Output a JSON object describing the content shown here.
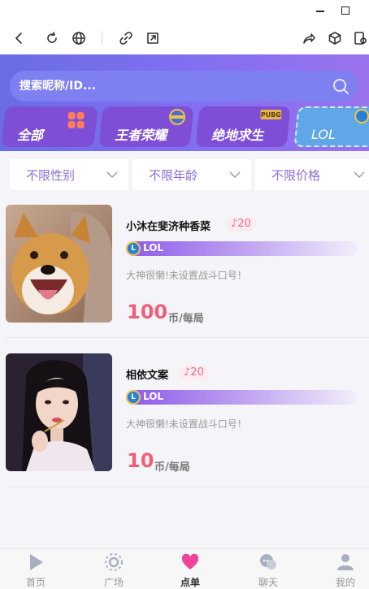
{
  "window": {
    "minimize_icon": "minimize-icon",
    "maximize_icon": "maximize-icon"
  },
  "toolbar": {
    "icons": [
      "back-icon",
      "refresh-icon",
      "globe-icon",
      "link-icon",
      "external-open-icon",
      "share-icon",
      "cube-icon",
      "screenshot-icon"
    ]
  },
  "search": {
    "placeholder": "搜索昵称/ID..."
  },
  "game_tabs": [
    {
      "label": "全部",
      "icon": "grid-icon"
    },
    {
      "label": "王者荣耀",
      "icon": "kings-glory-logo-icon"
    },
    {
      "label": "绝地求生",
      "icon": "pubg-logo-icon"
    },
    {
      "label": "LOL",
      "icon": "lol-logo-icon",
      "active": true
    }
  ],
  "filters": [
    {
      "label": "不限性别"
    },
    {
      "label": "不限年龄"
    },
    {
      "label": "不限价格"
    }
  ],
  "players": [
    {
      "name": "小沐在斐济种香菜",
      "badge": "♪20",
      "game": "LOL",
      "signature": "大神很懒!未设置战斗口号！",
      "price": "100",
      "unit": "币/每局",
      "photo": "shiba-dog-photo"
    },
    {
      "name": "相依文案",
      "badge": "♪20",
      "game": "LOL",
      "signature": "大神很懒!未设置战斗口号！",
      "price": "10",
      "unit": "币/每局",
      "photo": "girl-portrait-photo"
    }
  ],
  "bottom_nav": [
    {
      "label": "首页",
      "icon": "play-icon"
    },
    {
      "label": "广场",
      "icon": "plaza-icon"
    },
    {
      "label": "点单",
      "icon": "heart-icon",
      "active": true
    },
    {
      "label": "聊天",
      "icon": "chat-icon"
    },
    {
      "label": "我的",
      "icon": "user-icon"
    }
  ],
  "colors": {
    "accent": "#7e4fd6",
    "price": "#ee6079",
    "active_nav": "#f0449a"
  }
}
